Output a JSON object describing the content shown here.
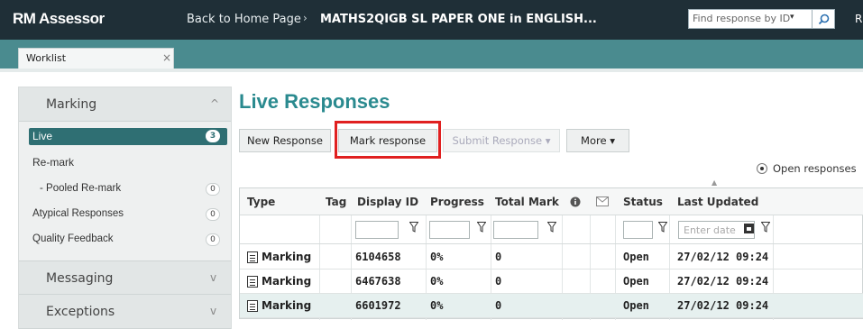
{
  "app": {
    "brand": "RM Assessor",
    "breadcrumb_home": "Back to Home Page",
    "breadcrumb_sep": "›",
    "breadcrumb_paper": "MATHS2QIGB SL PAPER ONE in ENGLISH...",
    "find_placeholder": "Find response by ID",
    "find_caret": "▾",
    "top_right_text": "R"
  },
  "tabs": [
    {
      "label": "Worklist",
      "close": "×"
    }
  ],
  "sidebar": {
    "sections": [
      {
        "title": "Marking",
        "chevron": "^"
      },
      {
        "title": "Messaging",
        "chevron": "v"
      },
      {
        "title": "Exceptions",
        "chevron": "v"
      }
    ],
    "items": [
      {
        "label": "Live",
        "count": "3"
      },
      {
        "label": "Re-mark",
        "count": ""
      },
      {
        "label": "- Pooled Re-mark",
        "count": "0"
      },
      {
        "label": "Atypical Responses",
        "count": "0"
      },
      {
        "label": "Quality Feedback",
        "count": "0"
      }
    ]
  },
  "main": {
    "title": "Live Responses",
    "buttons": {
      "new_response": "New Response",
      "mark_response": "Mark response",
      "submit_response": "Submit Response  ▾",
      "more": "More ▾"
    },
    "radio_label": "Open responses",
    "columns": [
      "Type",
      "Tag",
      "Display ID",
      "Progress",
      "Total Mark",
      "",
      "",
      "Status",
      "Last Updated"
    ],
    "date_placeholder": "Enter date",
    "rows": [
      {
        "type": "Marking",
        "tag": "",
        "display_id": "6104658",
        "progress": "0%",
        "total_mark": "0",
        "status": "Open",
        "last_updated": "27/02/12 09:24",
        "selected": false
      },
      {
        "type": "Marking",
        "tag": "",
        "display_id": "6467638",
        "progress": "0%",
        "total_mark": "0",
        "status": "Open",
        "last_updated": "27/02/12 09:24",
        "selected": false
      },
      {
        "type": "Marking",
        "tag": "",
        "display_id": "6601972",
        "progress": "0%",
        "total_mark": "0",
        "status": "Open",
        "last_updated": "27/02/12 09:24",
        "selected": true
      }
    ]
  },
  "colors": {
    "topbar": "#1f2f37",
    "accent_teal": "#2a8a8f",
    "tabstrip": "#4a8b8f",
    "highlight_red": "#e02020"
  },
  "icons": {
    "search": "search-icon",
    "filter": "filter-funnel-icon",
    "calendar": "calendar-icon",
    "document": "document-icon",
    "info": "info-icon",
    "message": "envelope-icon"
  }
}
